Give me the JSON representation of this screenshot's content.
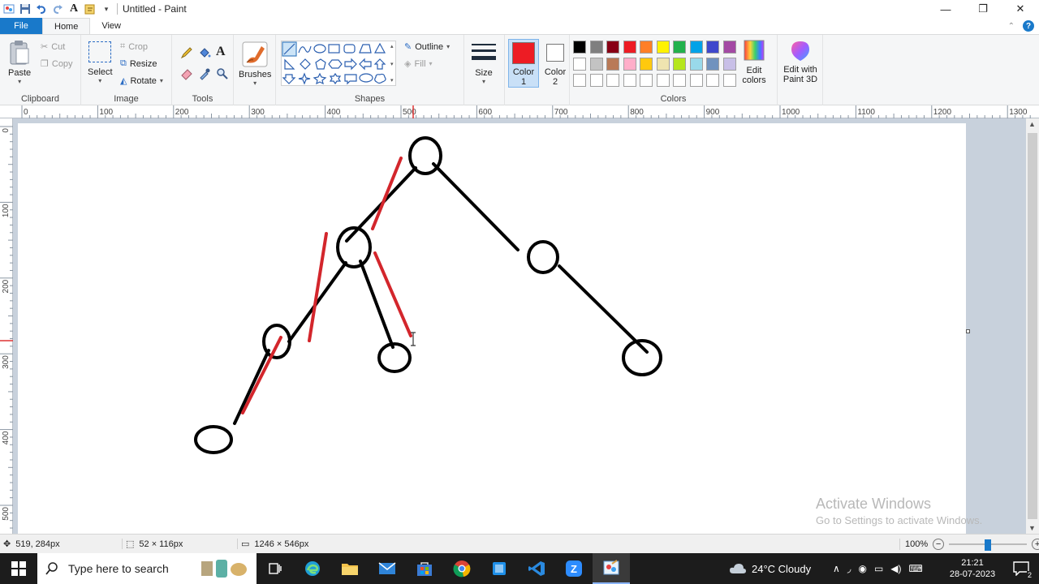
{
  "window": {
    "title": "Untitled - Paint"
  },
  "tabs": [
    {
      "label": "File"
    },
    {
      "label": "Home"
    },
    {
      "label": "View"
    }
  ],
  "ribbon": {
    "clipboard": {
      "group_label": "Clipboard",
      "paste": "Paste",
      "cut": "Cut",
      "copy": "Copy"
    },
    "image": {
      "group_label": "Image",
      "select": "Select",
      "crop": "Crop",
      "resize": "Resize",
      "rotate": "Rotate"
    },
    "tools": {
      "group_label": "Tools"
    },
    "brushes": {
      "label": "Brushes"
    },
    "shapes": {
      "group_label": "Shapes",
      "outline": "Outline",
      "fill": "Fill"
    },
    "size": {
      "label": "Size"
    },
    "color1": {
      "label": "Color 1",
      "value": "#ed1c24"
    },
    "color2": {
      "label": "Color 2",
      "value": "#ffffff"
    },
    "colors": {
      "group_label": "Colors",
      "row1": [
        "#000000",
        "#7f7f7f",
        "#880015",
        "#ed1c24",
        "#ff7f27",
        "#fff200",
        "#22b14c",
        "#00a2e8",
        "#3f48cc",
        "#a349a4"
      ],
      "row2": [
        "#ffffff",
        "#c3c3c3",
        "#b97a57",
        "#ffaec9",
        "#ffc90e",
        "#efe4b0",
        "#b5e61d",
        "#99d9ea",
        "#7092be",
        "#c8bfe7"
      ]
    },
    "edit_colors": "Edit colors",
    "edit_3d": "Edit with Paint 3D"
  },
  "ruler": {
    "h_ticks": [
      "0",
      "100",
      "200",
      "300",
      "400",
      "500",
      "600",
      "700",
      "800",
      "900",
      "1000",
      "1100",
      "1200",
      "1300"
    ],
    "v_ticks": [
      "0",
      "100",
      "200",
      "300",
      "400",
      "500"
    ]
  },
  "drawing": {
    "stroke_black": "#000000",
    "stroke_red": "#d3262c"
  },
  "watermark": {
    "line1": "Activate Windows",
    "line2": "Go to Settings to activate Windows."
  },
  "status": {
    "cursor_pos": "519, 284px",
    "selection_size": "52 × 116px",
    "image_size": "1246 × 546px",
    "zoom": "100%",
    "zoom_fraction": 0.5
  },
  "taskbar": {
    "search_placeholder": "Type here to search",
    "weather": "24°C  Cloudy",
    "time": "21:21",
    "date": "28-07-2023",
    "notifications": "2"
  }
}
